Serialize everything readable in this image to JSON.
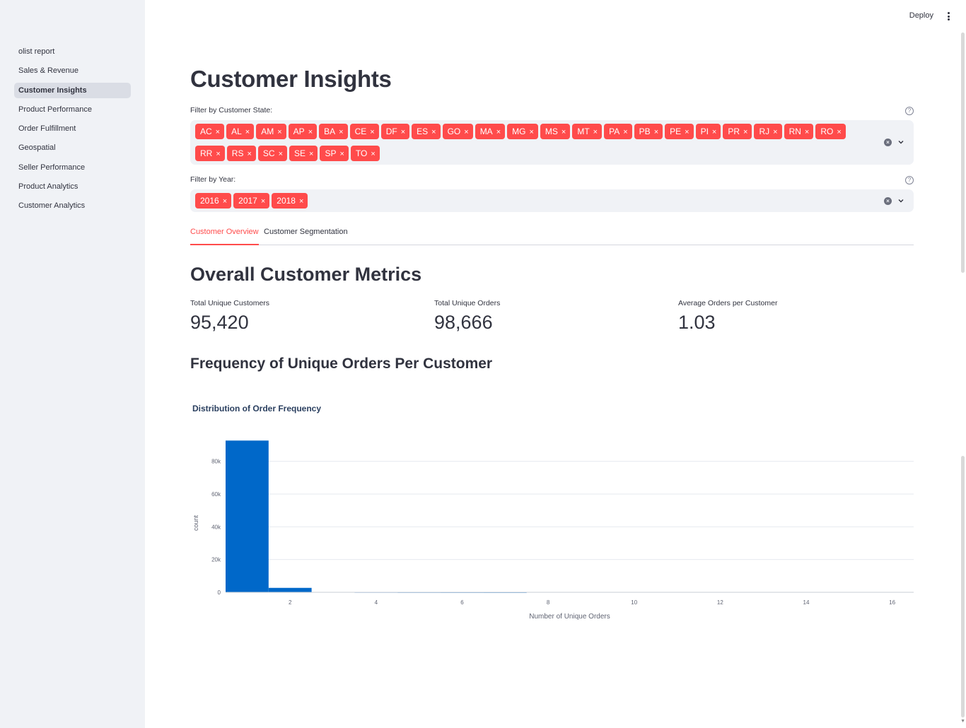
{
  "sidebar": {
    "items": [
      {
        "label": "olist report",
        "active": false
      },
      {
        "label": "Sales & Revenue",
        "active": false
      },
      {
        "label": "Customer Insights",
        "active": true
      },
      {
        "label": "Product Performance",
        "active": false
      },
      {
        "label": "Order Fulfillment",
        "active": false
      },
      {
        "label": "Geospatial",
        "active": false
      },
      {
        "label": "Seller Performance",
        "active": false
      },
      {
        "label": "Product Analytics",
        "active": false
      },
      {
        "label": "Customer Analytics",
        "active": false
      }
    ]
  },
  "header": {
    "deploy_label": "Deploy"
  },
  "page": {
    "title": "Customer Insights"
  },
  "filters": {
    "state": {
      "label": "Filter by Customer State:",
      "selected": [
        "AC",
        "AL",
        "AM",
        "AP",
        "BA",
        "CE",
        "DF",
        "ES",
        "GO",
        "MA",
        "MG",
        "MS",
        "MT",
        "PA",
        "PB",
        "PE",
        "PI",
        "PR",
        "RJ",
        "RN",
        "RO",
        "RR",
        "RS",
        "SC",
        "SE",
        "SP",
        "TO"
      ]
    },
    "year": {
      "label": "Filter by Year:",
      "selected": [
        "2016",
        "2017",
        "2018"
      ]
    }
  },
  "tabs": [
    {
      "label": "Customer Overview",
      "active": true
    },
    {
      "label": "Customer Segmentation",
      "active": false
    }
  ],
  "overview": {
    "section_title": "Overall Customer Metrics",
    "metrics": [
      {
        "label": "Total Unique Customers",
        "value": "95,420"
      },
      {
        "label": "Total Unique Orders",
        "value": "98,666"
      },
      {
        "label": "Average Orders per Customer",
        "value": "1.03"
      }
    ],
    "frequency_title": "Frequency of Unique Orders Per Customer"
  },
  "colors": {
    "accent": "#ff4b4b",
    "bar": "#0068c9",
    "chip_bg": "#ff4b4b"
  },
  "chart_data": {
    "type": "bar",
    "title": "Distribution of Order Frequency",
    "xlabel": "Number of Unique Orders",
    "ylabel": "count",
    "x": [
      1,
      2,
      3,
      4,
      5,
      6,
      7
    ],
    "values": [
      92700,
      2700,
      200,
      80,
      40,
      20,
      10
    ],
    "xlim": [
      0.5,
      16.5
    ],
    "ylim": [
      0,
      95000
    ],
    "x_ticks": [
      2,
      4,
      6,
      8,
      10,
      12,
      14,
      16
    ],
    "y_ticks": [
      0,
      20000,
      40000,
      60000,
      80000
    ],
    "y_tick_labels": [
      "0",
      "20k",
      "40k",
      "60k",
      "80k"
    ],
    "grid": true
  }
}
